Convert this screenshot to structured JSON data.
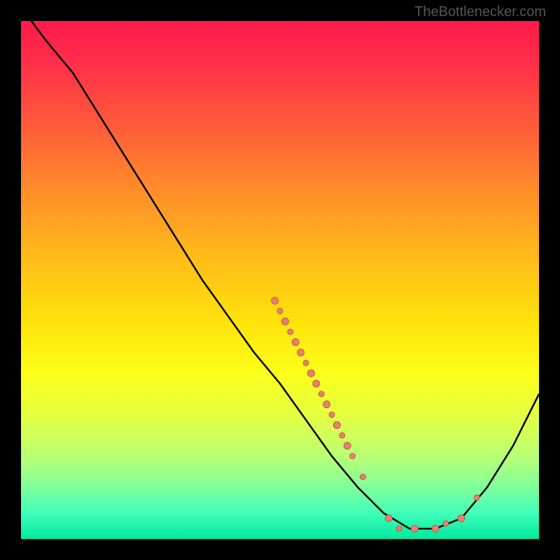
{
  "watermark": "TheBottlenecker.com",
  "chart_data": {
    "type": "line",
    "title": "",
    "xlabel": "",
    "ylabel": "",
    "xlim": [
      0,
      100
    ],
    "ylim": [
      0,
      100
    ],
    "curve": [
      {
        "x": 2,
        "y": 100
      },
      {
        "x": 5,
        "y": 96
      },
      {
        "x": 10,
        "y": 90
      },
      {
        "x": 15,
        "y": 82
      },
      {
        "x": 20,
        "y": 74
      },
      {
        "x": 25,
        "y": 66
      },
      {
        "x": 30,
        "y": 58
      },
      {
        "x": 35,
        "y": 50
      },
      {
        "x": 40,
        "y": 43
      },
      {
        "x": 45,
        "y": 36
      },
      {
        "x": 50,
        "y": 30
      },
      {
        "x": 55,
        "y": 23
      },
      {
        "x": 60,
        "y": 16
      },
      {
        "x": 65,
        "y": 10
      },
      {
        "x": 70,
        "y": 5
      },
      {
        "x": 75,
        "y": 2
      },
      {
        "x": 80,
        "y": 2
      },
      {
        "x": 85,
        "y": 4
      },
      {
        "x": 90,
        "y": 10
      },
      {
        "x": 95,
        "y": 18
      },
      {
        "x": 100,
        "y": 28
      }
    ],
    "markers": [
      {
        "x": 49,
        "y": 46,
        "r": 5
      },
      {
        "x": 50,
        "y": 44,
        "r": 4
      },
      {
        "x": 51,
        "y": 42,
        "r": 5
      },
      {
        "x": 52,
        "y": 40,
        "r": 4
      },
      {
        "x": 53,
        "y": 38,
        "r": 5
      },
      {
        "x": 54,
        "y": 36,
        "r": 5
      },
      {
        "x": 55,
        "y": 34,
        "r": 4
      },
      {
        "x": 56,
        "y": 32,
        "r": 5
      },
      {
        "x": 57,
        "y": 30,
        "r": 5
      },
      {
        "x": 58,
        "y": 28,
        "r": 4
      },
      {
        "x": 59,
        "y": 26,
        "r": 5
      },
      {
        "x": 60,
        "y": 24,
        "r": 4
      },
      {
        "x": 61,
        "y": 22,
        "r": 5
      },
      {
        "x": 62,
        "y": 20,
        "r": 4
      },
      {
        "x": 63,
        "y": 18,
        "r": 5
      },
      {
        "x": 64,
        "y": 16,
        "r": 4
      },
      {
        "x": 66,
        "y": 12,
        "r": 4
      },
      {
        "x": 71,
        "y": 4,
        "r": 5
      },
      {
        "x": 73,
        "y": 2,
        "r": 4
      },
      {
        "x": 76,
        "y": 2,
        "r": 5
      },
      {
        "x": 80,
        "y": 2,
        "r": 5
      },
      {
        "x": 82,
        "y": 3,
        "r": 4
      },
      {
        "x": 85,
        "y": 4,
        "r": 5
      },
      {
        "x": 88,
        "y": 8,
        "r": 4
      }
    ],
    "colors": {
      "curve": "#000000",
      "marker_fill": "#e88070",
      "marker_stroke": "#c05a4a"
    }
  }
}
